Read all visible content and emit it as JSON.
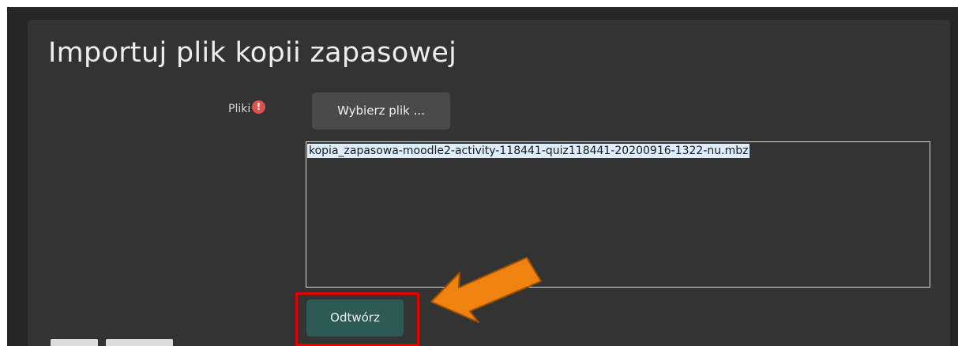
{
  "page": {
    "title": "Importuj plik kopii zapasowej"
  },
  "form": {
    "files_label": "Pliki",
    "required_icon": "exclamation-circle-icon",
    "choose_file_label": "Wybierz plik ...",
    "selected_file": "kopia_zapasowa-moodle2-activity-118441-quiz118441-20200916-1322-nu.mbz",
    "restore_label": "Odtwórz"
  },
  "annotations": {
    "arrow_icon": "orange-arrow-icon",
    "arrow_color": "#f0820f",
    "highlight_color": "#e00000"
  },
  "colors": {
    "background": "#262626",
    "card": "#333333",
    "primary_button": "#2e5a56",
    "secondary_button": "#4a4a4a",
    "required": "#d9534f"
  }
}
